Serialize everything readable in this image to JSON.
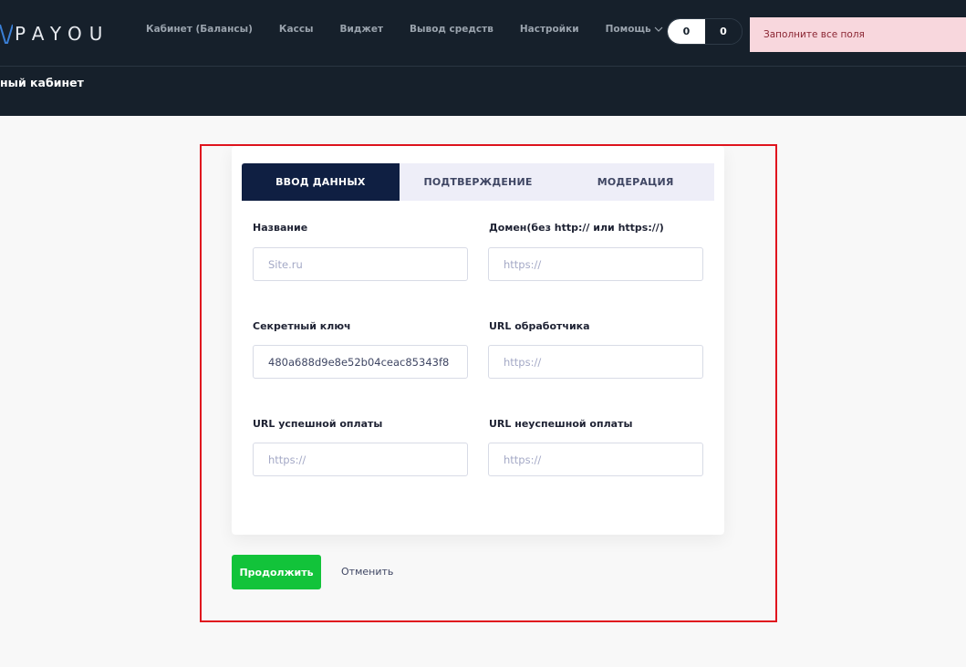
{
  "header": {
    "logo_text": "PAYOU",
    "nav": [
      {
        "label": "Кабинет (Балансы)"
      },
      {
        "label": "Кассы"
      },
      {
        "label": "Виджет"
      },
      {
        "label": "Вывод средств"
      },
      {
        "label": "Настройки"
      },
      {
        "label": "Помощь"
      }
    ],
    "balance": [
      "0",
      "0"
    ],
    "alert": "Заполните все поля",
    "page_title": "ный кабинет"
  },
  "tabs": [
    {
      "label": "ВВОД ДАННЫХ",
      "active": true
    },
    {
      "label": "ПОДТВЕРЖДЕНИЕ",
      "active": false
    },
    {
      "label": "МОДЕРАЦИЯ",
      "active": false
    }
  ],
  "form": {
    "name": {
      "label": "Название",
      "placeholder": "Site.ru",
      "value": ""
    },
    "domain": {
      "label": "Домен(без http:// или https://)",
      "placeholder": "https://",
      "value": ""
    },
    "secret": {
      "label": "Секретный ключ",
      "placeholder": "",
      "value": "480a688d9e8e52b04ceac85343f8"
    },
    "handler_url": {
      "label": "URL обработчика",
      "placeholder": "https://",
      "value": ""
    },
    "success_url": {
      "label": "URL успешной оплаты",
      "placeholder": "https://",
      "value": ""
    },
    "fail_url": {
      "label": "URL неуспешной оплаты",
      "placeholder": "https://",
      "value": ""
    }
  },
  "actions": {
    "continue_label": "Продолжить",
    "cancel_label": "Отменить"
  },
  "colors": {
    "header_bg": "#16202b",
    "tab_active": "#0f1f42",
    "tab_inactive_bg": "#eeeef8",
    "primary_button": "#12c33a",
    "alert_bg": "#f8d7dd",
    "highlight_border": "#e0141e"
  }
}
